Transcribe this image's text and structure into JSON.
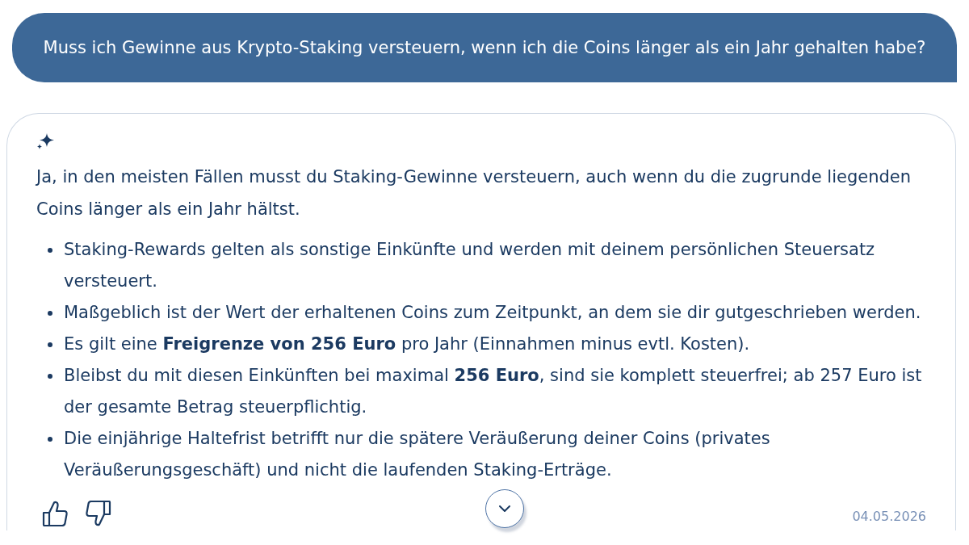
{
  "user_message": {
    "text": "Muss ich Gewinne aus Krypto-Staking versteuern, wenn ich die Coins länger als ein Jahr gehalten habe?"
  },
  "answer": {
    "intro": "Ja, in den meisten Fällen musst du Staking-Gewinne versteuern, auch wenn du die zugrunde liegenden Coins länger als ein Jahr hältst.",
    "bullets": [
      "Staking-Rewards gelten als sonstige Einkünfte und werden mit deinem persönlichen Steuersatz versteuert.",
      "Maßgeblich ist der Wert der erhaltenen Coins zum Zeitpunkt, an dem sie dir gutgeschrieben werden.",
      "Es gilt eine **Freigrenze von 256 Euro** pro Jahr (Einnahmen minus evtl. Kosten).",
      "Bleibst du mit diesen Einkünften bei maximal **256 Euro**, sind sie komplett steuerfrei; ab 257 Euro ist der gesamte Betrag steuerpflichtig.",
      "Die einjährige Haltefrist betrifft nur die spätere Veräußerung deiner Coins (privates Veräußerungsgeschäft) und nicht die laufenden Staking-Erträge."
    ],
    "date": "04.05.2026"
  }
}
